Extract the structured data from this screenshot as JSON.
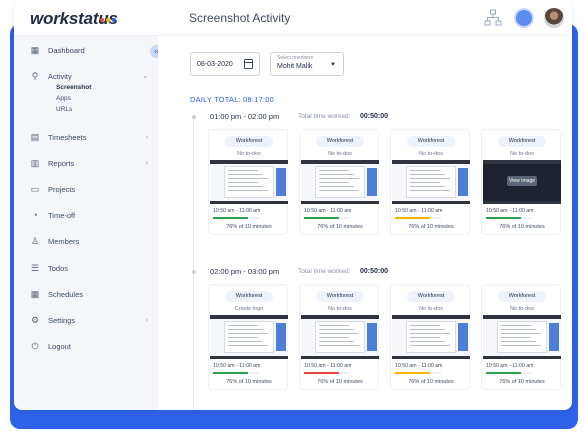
{
  "brand": {
    "logo_text": "workstatus",
    "logo_dot_colors": [
      "#e8473f",
      "#f5b400",
      "#2e62e8"
    ]
  },
  "header": {
    "title": "Screenshot Activity",
    "icons": [
      "org-chart-icon",
      "message-icon",
      "user-avatar"
    ]
  },
  "sidebar": {
    "collapse_icon": "«",
    "items": [
      {
        "label": "Dashboard",
        "icon": "dashboard-icon",
        "has_chevron": false
      },
      {
        "label": "Activity",
        "icon": "activity-icon",
        "has_chevron": true,
        "expanded": true,
        "children": [
          {
            "label": "Screenshot",
            "active": true
          },
          {
            "label": "Apps",
            "active": false
          },
          {
            "label": "URLs",
            "active": false
          }
        ]
      },
      {
        "label": "Timesheets",
        "icon": "timesheet-icon",
        "has_chevron": true
      },
      {
        "label": "Reports",
        "icon": "reports-icon",
        "has_chevron": true
      },
      {
        "label": "Projects",
        "icon": "projects-icon",
        "has_chevron": false
      },
      {
        "label": "Time-off",
        "icon": "timeoff-icon",
        "has_chevron": false
      },
      {
        "label": "Members",
        "icon": "members-icon",
        "has_chevron": false
      },
      {
        "label": "Todos",
        "icon": "todos-icon",
        "has_chevron": false
      },
      {
        "label": "Schedules",
        "icon": "schedules-icon",
        "has_chevron": false
      },
      {
        "label": "Settings",
        "icon": "settings-icon",
        "has_chevron": true
      },
      {
        "label": "Logout",
        "icon": "logout-icon",
        "has_chevron": false
      }
    ]
  },
  "filters": {
    "date_value": "08-03-2020",
    "members_label": "Select members",
    "members_value": "Mohit Malik"
  },
  "daily_total": "DAILY TOTAL: 08:17:00",
  "colors": {
    "accent": "#2e62e8",
    "bar_green": "#2e9e4f",
    "bar_yellow": "#f5b400",
    "bar_red": "#e8473f"
  },
  "slots": [
    {
      "time_range": "01:00 pm - 02:00 pm",
      "total_label": "Total time worked:",
      "total_value": "00:50:00",
      "cards": [
        {
          "project": "Workforest",
          "todo": "No to-dos",
          "time": "10:50 am - 11:00 am",
          "bar_color": "#2e9e4f",
          "activity": 0.76,
          "pct_text": "76% of 10 minutes",
          "shot": "light"
        },
        {
          "project": "Workforest",
          "todo": "No to-dos",
          "time": "10:50 am - 11:00 am",
          "bar_color": "#2e9e4f",
          "activity": 0.76,
          "pct_text": "76% of 10 minutes",
          "shot": "light"
        },
        {
          "project": "Workforest",
          "todo": "No to-dos",
          "time": "10:50 am - 11:00 am",
          "bar_color": "#f5b400",
          "activity": 0.76,
          "pct_text": "76% of 10 minutes",
          "shot": "light"
        },
        {
          "project": "Workforest",
          "todo": "No to-dos",
          "time": "10:50 am - 11:00 am",
          "bar_color": "#2e9e4f",
          "activity": 0.76,
          "pct_text": "76% of 10 minutes",
          "shot": "dark",
          "hover_label": "View Image"
        }
      ]
    },
    {
      "time_range": "02:00 pm - 03:00 pm",
      "total_label": "Total time worked:",
      "total_value": "00:50:00",
      "cards": [
        {
          "project": "Workforest",
          "todo": "Create logo",
          "time": "10:50 am - 11:00 am",
          "bar_color": "#2e9e4f",
          "activity": 0.76,
          "pct_text": "76% of 10 minutes",
          "shot": "light"
        },
        {
          "project": "Workforest",
          "todo": "No to-dos",
          "time": "10:50 am - 11:00 am",
          "bar_color": "#e8473f",
          "activity": 0.76,
          "pct_text": "76% of 10 minutes",
          "shot": "light"
        },
        {
          "project": "Workforest",
          "todo": "No to-dos",
          "time": "10:50 am - 11:00 am",
          "bar_color": "#f5b400",
          "activity": 0.76,
          "pct_text": "76% of 10 minutes",
          "shot": "light"
        },
        {
          "project": "Workforest",
          "todo": "No to-dos",
          "time": "10:50 am - 11:00 am",
          "bar_color": "#2e9e4f",
          "activity": 0.76,
          "pct_text": "76% of 10 minutes",
          "shot": "light"
        }
      ]
    }
  ]
}
